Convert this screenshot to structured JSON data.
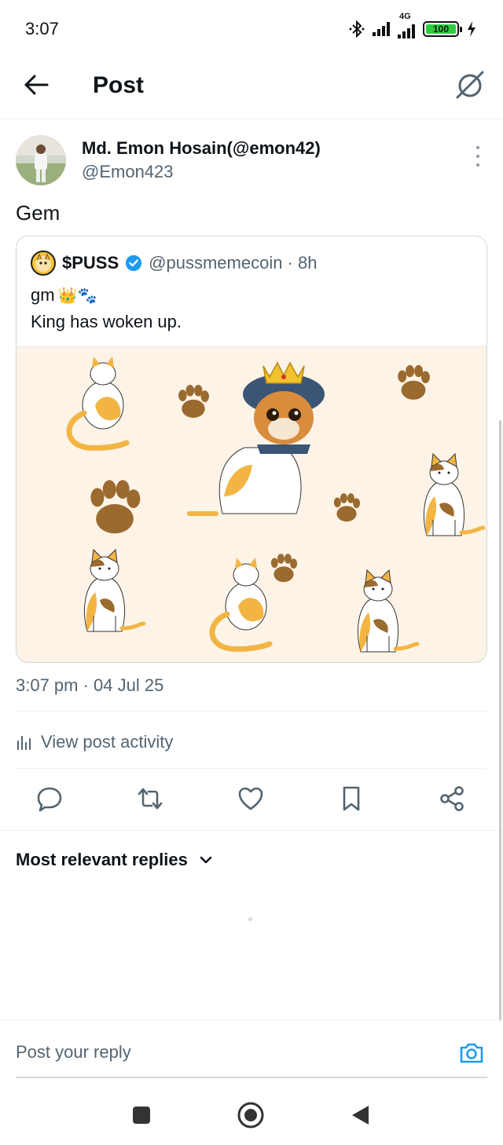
{
  "status_bar": {
    "time": "3:07",
    "network": "4G",
    "battery": "100"
  },
  "header": {
    "title": "Post",
    "back_icon": "arrow-left-icon",
    "grok_icon": "grok-icon"
  },
  "post": {
    "author_name": "Md. Emon Hosain(@emon42)",
    "author_handle": "@Emon423",
    "text": "Gem",
    "timestamp": "3:07 pm · 04 Jul 25"
  },
  "quote": {
    "name": "$PUSS",
    "handle_time": "@pussmemecoin · 8h",
    "line1": "gm",
    "line1_emoji": "👑🐾",
    "line2": "King has woken up."
  },
  "activity": {
    "label": "View post activity"
  },
  "actions": [
    "reply-icon",
    "repost-icon",
    "like-icon",
    "bookmark-icon",
    "share-icon"
  ],
  "replies": {
    "sort_label": "Most relevant replies"
  },
  "reply_bar": {
    "placeholder": "Post your reply"
  },
  "colors": {
    "accent": "#1d9bf0",
    "muted": "#536471",
    "media_bg": "#fdf3e6",
    "paw": "#9a6a2f",
    "cat_orange": "#f2b544"
  }
}
